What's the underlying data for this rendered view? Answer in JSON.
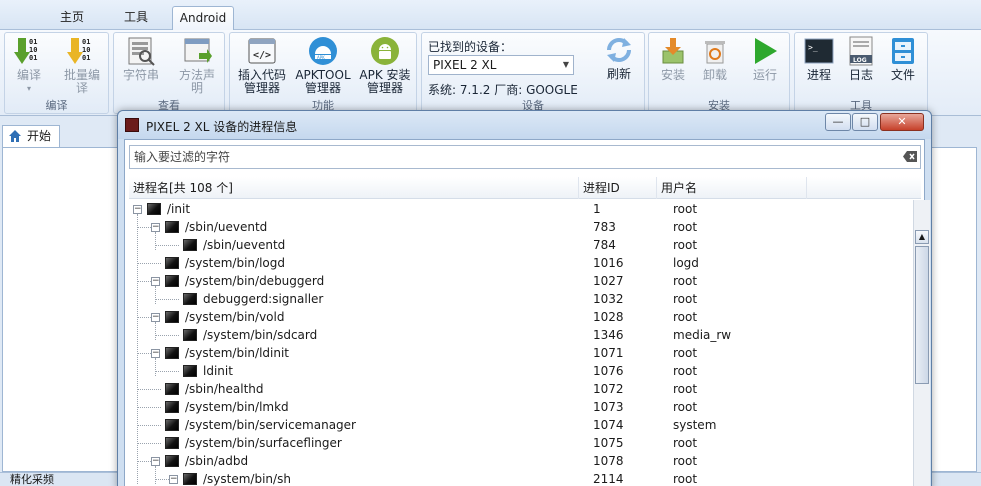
{
  "ribbon_tabs": [
    {
      "label": "主页",
      "active": false
    },
    {
      "label": "工具",
      "active": false
    },
    {
      "label": "Android",
      "active": true
    }
  ],
  "groups": {
    "compile": {
      "label": "编译",
      "compile_btn": "编译",
      "batch_btn_line1": "批量编",
      "batch_btn_line2": "译"
    },
    "view": {
      "label": "查看",
      "strings_btn": "字符串",
      "method_btn_line1": "方法声",
      "method_btn_line2": "明"
    },
    "function": {
      "label": "功能",
      "inject_line1": "插入代码",
      "inject_line2": "管理器",
      "apktool_line1": "APKTOOL",
      "apktool_line2": "管理器",
      "apkinstall_line1": "APK 安装",
      "apkinstall_line2": "管理器"
    },
    "device": {
      "label": "设备",
      "found_label": "已找到的设备：",
      "selected_device": "PIXEL 2 XL",
      "system_info": "系统: 7.1.2  厂商: GOOGLE",
      "refresh_btn": "刷新"
    },
    "install": {
      "label": "安装",
      "install_btn": "安装",
      "uninstall_btn": "卸载",
      "run_btn": "运行"
    },
    "tools": {
      "label": "工具",
      "process_btn": "进程",
      "log_btn": "日志",
      "file_btn": "文件"
    }
  },
  "doc_tab": {
    "label": "开始"
  },
  "status_bar": {
    "text": "精化采频"
  },
  "dialog": {
    "title": "PIXEL 2 XL 设备的进程信息",
    "filter_placeholder": "输入要过滤的字符",
    "columns": {
      "name": "进程名[共 108 个]",
      "pid": "进程ID",
      "user": "用户名"
    },
    "processes": [
      {
        "name": "/init",
        "pid": "1",
        "user": "root",
        "level": 0,
        "toggle": "-"
      },
      {
        "name": "/sbin/ueventd",
        "pid": "783",
        "user": "root",
        "level": 1,
        "toggle": "-"
      },
      {
        "name": "/sbin/ueventd",
        "pid": "784",
        "user": "root",
        "level": 2,
        "toggle": ""
      },
      {
        "name": "/system/bin/logd",
        "pid": "1016",
        "user": "logd",
        "level": 1,
        "toggle": ""
      },
      {
        "name": "/system/bin/debuggerd",
        "pid": "1027",
        "user": "root",
        "level": 1,
        "toggle": "-"
      },
      {
        "name": "debuggerd:signaller",
        "pid": "1032",
        "user": "root",
        "level": 2,
        "toggle": ""
      },
      {
        "name": "/system/bin/vold",
        "pid": "1028",
        "user": "root",
        "level": 1,
        "toggle": "-"
      },
      {
        "name": "/system/bin/sdcard",
        "pid": "1346",
        "user": "media_rw",
        "level": 2,
        "toggle": ""
      },
      {
        "name": "/system/bin/ldinit",
        "pid": "1071",
        "user": "root",
        "level": 1,
        "toggle": "-"
      },
      {
        "name": "ldinit",
        "pid": "1076",
        "user": "root",
        "level": 2,
        "toggle": ""
      },
      {
        "name": "/sbin/healthd",
        "pid": "1072",
        "user": "root",
        "level": 1,
        "toggle": ""
      },
      {
        "name": "/system/bin/lmkd",
        "pid": "1073",
        "user": "root",
        "level": 1,
        "toggle": ""
      },
      {
        "name": "/system/bin/servicemanager",
        "pid": "1074",
        "user": "system",
        "level": 1,
        "toggle": ""
      },
      {
        "name": "/system/bin/surfaceflinger",
        "pid": "1075",
        "user": "root",
        "level": 1,
        "toggle": ""
      },
      {
        "name": "/sbin/adbd",
        "pid": "1078",
        "user": "root",
        "level": 1,
        "toggle": "-"
      },
      {
        "name": "/system/bin/sh",
        "pid": "2114",
        "user": "root",
        "level": 2,
        "toggle": "-"
      }
    ]
  },
  "colors": {
    "accent": "#2f6fb5",
    "ribbon_bg": "#e3ecf7",
    "run_green": "#2ea82e",
    "android_green": "#8ab33a"
  }
}
